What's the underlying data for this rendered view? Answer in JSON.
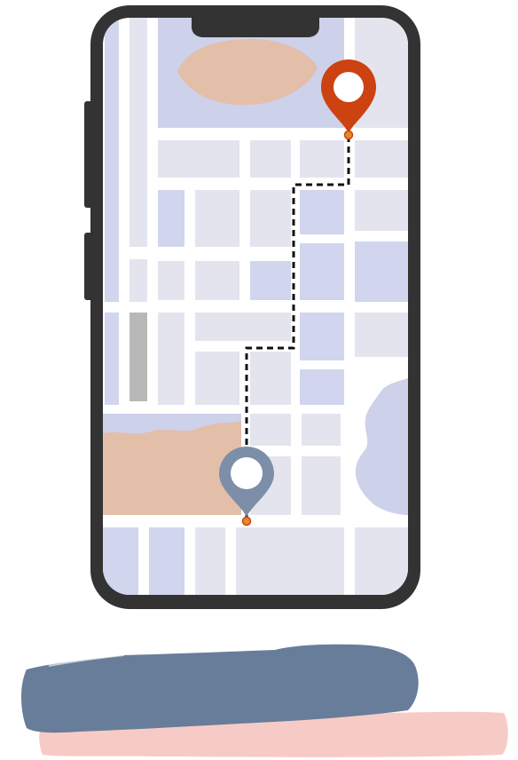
{
  "illustration": {
    "subject": "phone-map-route",
    "colors": {
      "background": "#ffffff",
      "phone_frame": "#333333",
      "map_base": "#ffffff",
      "block_light": "#e4e4ee",
      "block_blue": "#d1d6ee",
      "road_gray": "#b8b8b8",
      "land_peach": "#e3bea9",
      "water_blue": "#cdd1ea",
      "route_line": "#111111",
      "pin_destination": "#cc4210",
      "pin_origin": "#7d8ea8",
      "pin_dot": "#e58a2a",
      "brush_blue": "#687d99",
      "brush_pink": "#f7cbc5"
    },
    "pins": [
      {
        "role": "destination",
        "color_key": "pin_destination"
      },
      {
        "role": "origin",
        "color_key": "pin_origin"
      }
    ],
    "route": {
      "style": "dashed"
    },
    "brush_strokes": [
      {
        "color_key": "brush_blue"
      },
      {
        "color_key": "brush_pink"
      }
    ]
  }
}
